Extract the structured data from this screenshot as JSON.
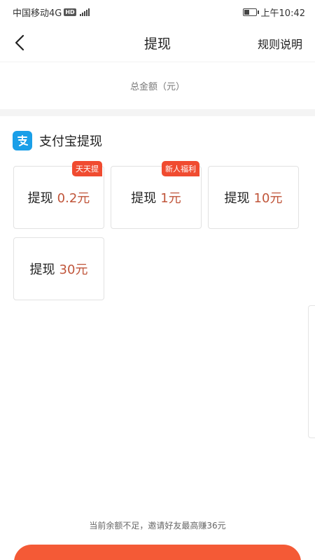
{
  "status_bar": {
    "carrier": "中国移动4G",
    "hd": "HD",
    "network": "4G",
    "time": "上午10:42"
  },
  "nav": {
    "title": "提现",
    "rules_label": "规则说明"
  },
  "total": {
    "label": "总金额（元）"
  },
  "section": {
    "icon": "alipay-icon",
    "title": "支付宝提现"
  },
  "options": [
    {
      "label": "提现",
      "amount": "0.2元",
      "badge": "天天提"
    },
    {
      "label": "提现",
      "amount": "1元",
      "badge": "新人福利"
    },
    {
      "label": "提现",
      "amount": "10元"
    },
    {
      "label": "提现",
      "amount": "30元"
    }
  ],
  "footer": {
    "notice": "当前余额不足，邀请好友最高赚36元"
  },
  "colors": {
    "accent": "#f45a36",
    "badge": "#f04b30",
    "amount": "#c0553a",
    "alipay": "#1a9fe8"
  }
}
